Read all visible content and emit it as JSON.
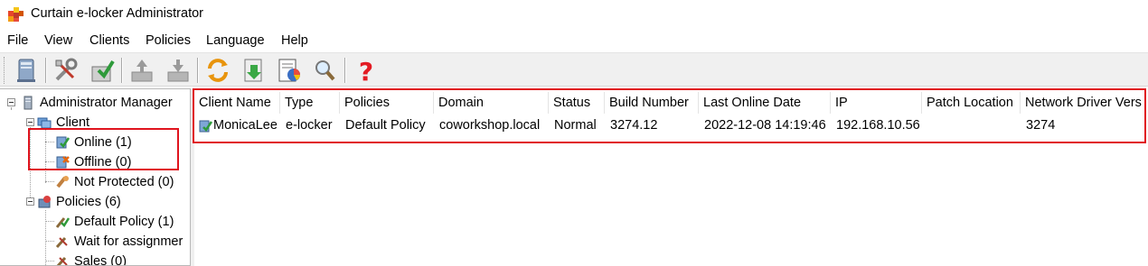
{
  "window": {
    "title": "Curtain e-locker Administrator"
  },
  "menu": [
    "File",
    "View",
    "Clients",
    "Policies",
    "Language",
    "Help"
  ],
  "toolbar": {
    "buttons": [
      "computer-icon",
      "tools-icon",
      "install-icon",
      "upload-disabled-icon",
      "download-disabled-icon",
      "refresh-icon",
      "update-icon",
      "report-icon",
      "search-icon",
      "help-icon"
    ]
  },
  "tree": {
    "root": "Administrator Manager",
    "client": "Client",
    "online": "Online (1)",
    "offline": "Offline (0)",
    "not_protected": "Not Protected (0)",
    "policies": "Policies (6)",
    "default_policy": "Default Policy (1)",
    "wait_assignment": "Wait for assignmer",
    "sales": "Sales (0)"
  },
  "table": {
    "columns": [
      "Client Name",
      "Type",
      "Policies",
      "Domain",
      "Status",
      "Build Number",
      "Last Online Date",
      "IP",
      "Patch Location",
      "Network Driver Vers"
    ],
    "rows": [
      [
        "MonicaLee",
        "e-locker",
        "Default Policy",
        "coworkshop.local",
        "Normal",
        "3274.12",
        "2022-12-08 14:19:46",
        "192.168.10.56",
        "",
        "3274"
      ]
    ]
  },
  "colors": {
    "highlight": "#e0141e",
    "help": "#e31b23"
  }
}
